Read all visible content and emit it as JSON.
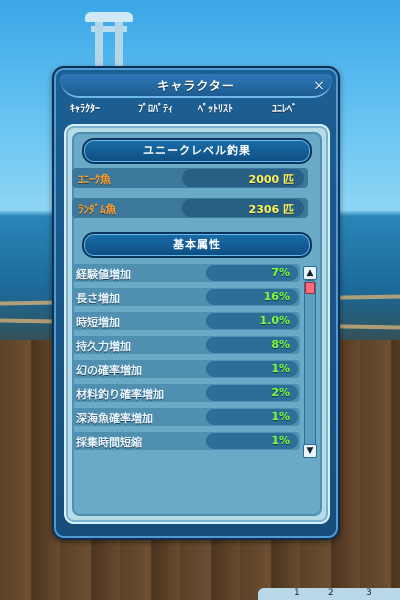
{
  "window": {
    "title": "キャラクター",
    "close_label": "×",
    "tabs": [
      {
        "label": "ｷｬﾗｸﾀｰ"
      },
      {
        "label": "ﾌﾟﾛﾊﾟﾃｨ"
      },
      {
        "label": "ﾍﾟｯﾄﾘｽﾄ"
      },
      {
        "label": "ﾕﾆﾚﾍﾞ"
      }
    ]
  },
  "sections": {
    "unique_level": {
      "title": "ユニークレベル釣果",
      "items": [
        {
          "label": "ﾕﾆｰｸ魚",
          "value": "2000 匹"
        },
        {
          "label": "ﾗﾝﾀﾞﾑ魚",
          "value": "2306 匹"
        }
      ]
    },
    "basic_attributes": {
      "title": "基本属性",
      "items": [
        {
          "label": "経験値増加",
          "value": "7%"
        },
        {
          "label": "長さ増加",
          "value": "16%"
        },
        {
          "label": "時短増加",
          "value": "1.0%"
        },
        {
          "label": "持久力増加",
          "value": "8%"
        },
        {
          "label": "幻の確率増加",
          "value": "1%"
        },
        {
          "label": "材料釣り確率増加",
          "value": "2%"
        },
        {
          "label": "深海魚確率増加",
          "value": "1%"
        },
        {
          "label": "採集時間短縮",
          "value": "1%"
        }
      ]
    }
  },
  "scrollbar": {
    "up_label": "▲",
    "down_label": "▼"
  },
  "bottom_tabs": [
    "1",
    "2",
    "3"
  ],
  "colors": {
    "window_bg": "#1c5f94",
    "panel_bg": "#6aaac7",
    "unique_label": "#ff9d2b",
    "unique_value": "#fff45a",
    "attribute_value": "#7dff3b",
    "scroll_thumb": "#ff6b7a"
  }
}
